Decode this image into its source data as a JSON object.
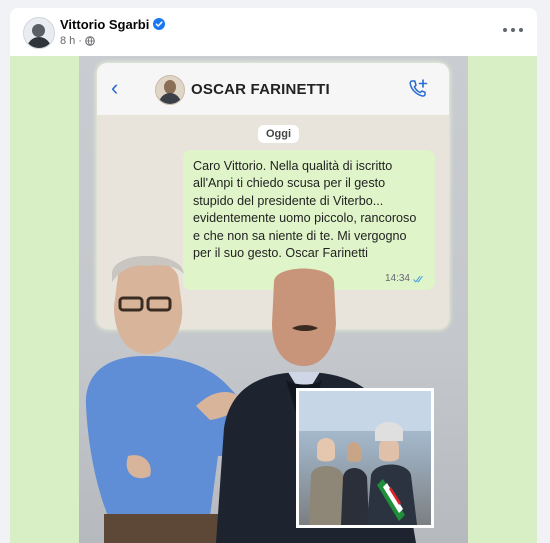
{
  "post": {
    "author": "Vittorio Sgarbi",
    "time": "8 h",
    "dot": "·",
    "icons": {
      "verified": "verified-badge-icon",
      "audience": "globe-icon",
      "more": "more-options-icon"
    }
  },
  "chat": {
    "back_icon": "back-chevron-icon",
    "contact_name": "OSCAR FARINETTI",
    "call_icon": "add-call-icon",
    "date_label": "Oggi",
    "message": "Caro Vittorio. Nella qualità di iscritto all'Anpi ti chiedo scusa per il gesto stupido del presidente di Viterbo... evidentemente uomo piccolo, rancoroso e che non sa niente di te. Mi vergogno per il suo gesto. Oscar Farinetti",
    "time": "14:34",
    "read_icon": "double-check-icon"
  },
  "colors": {
    "media_bg": "#d8efc6",
    "bubble": "#dff5c9",
    "accent_blue": "#2a6bd1",
    "verified": "#1877f2"
  }
}
